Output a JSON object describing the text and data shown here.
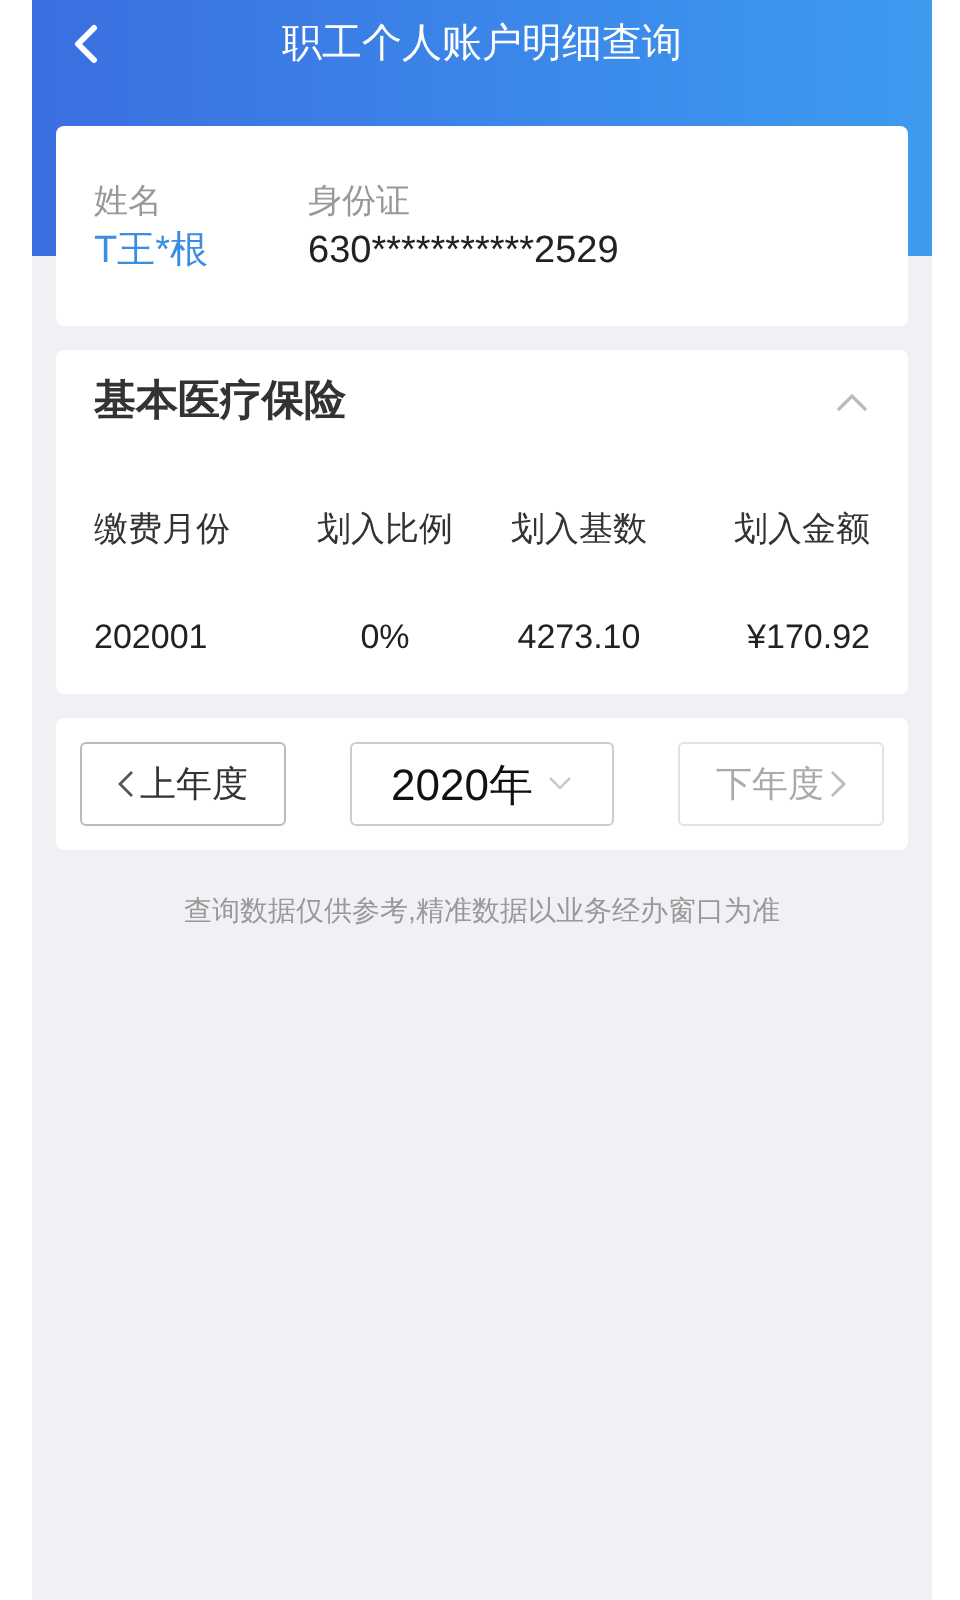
{
  "header": {
    "title": "职工个人账户明细查询"
  },
  "person": {
    "name_label": "姓名",
    "name": "T王*根",
    "id_label": "身份证",
    "id": "630***********2529"
  },
  "section": {
    "title": "基本医疗保险",
    "expanded": true,
    "columns": [
      "缴费月份",
      "划入比例",
      "划入基数",
      "划入金额"
    ],
    "rows": [
      [
        "202001",
        "0%",
        "4273.10",
        "¥170.92"
      ]
    ]
  },
  "year_nav": {
    "prev": {
      "label": "上年度",
      "disabled": false
    },
    "year": "2020年",
    "next": {
      "label": "下年度",
      "disabled": true
    }
  },
  "note": "查询数据仅供参考,精准数据以业务经办窗口为准"
}
